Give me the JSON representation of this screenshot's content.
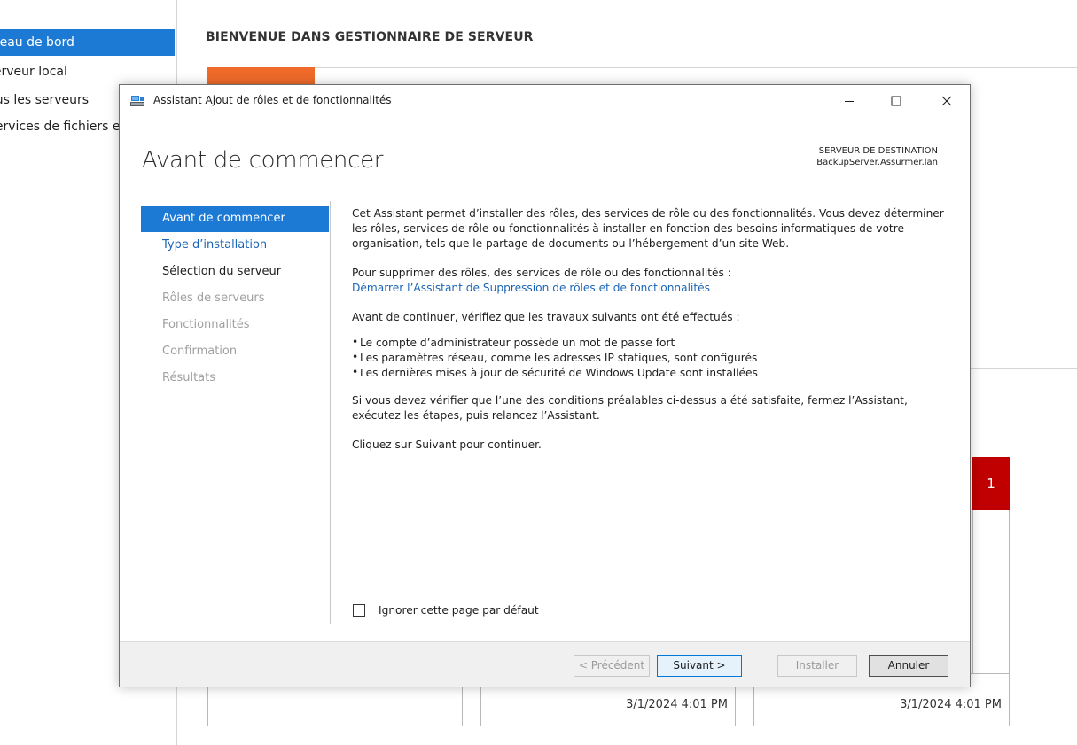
{
  "server_manager": {
    "nav": [
      {
        "label": "Tableau de bord",
        "active": true
      },
      {
        "label": "Serveur local",
        "active": false
      },
      {
        "label": "Tous les serveurs",
        "active": false
      },
      {
        "label": "Services de fichiers et de stockage",
        "active": false
      }
    ],
    "title": "BIENVENUE DANS GESTIONNAIRE DE SERVEUR",
    "badge_count": "1",
    "tile_timestamps": [
      "3/1/2024 4:01 PM",
      "3/1/2024 4:01 PM"
    ]
  },
  "wizard": {
    "window_title": "Assistant Ajout de rôles et de fonctionnalités",
    "heading": "Avant de commencer",
    "destination": {
      "label": "SERVEUR DE DESTINATION",
      "server": "BackupServer.Assurmer.lan"
    },
    "steps": [
      {
        "label": "Avant de commencer",
        "state": "active"
      },
      {
        "label": "Type d’installation",
        "state": "link"
      },
      {
        "label": "Sélection du serveur",
        "state": "normal"
      },
      {
        "label": "Rôles de serveurs",
        "state": "disabled"
      },
      {
        "label": "Fonctionnalités",
        "state": "disabled"
      },
      {
        "label": "Confirmation",
        "state": "disabled"
      },
      {
        "label": "Résultats",
        "state": "disabled"
      }
    ],
    "content": {
      "intro": "Cet Assistant permet d’installer des rôles, des services de rôle ou des fonctionnalités. Vous devez déterminer les rôles, services de rôle ou fonctionnalités à installer en fonction des besoins informatiques de votre organisation, tels que le partage de documents ou l’hébergement d’un site Web.",
      "remove_text": "Pour supprimer des rôles, des services de rôle ou des fonctionnalités :",
      "remove_link": "Démarrer l’Assistant de Suppression de rôles et de fonctionnalités",
      "prereq_intro": "Avant de continuer, vérifiez que les travaux suivants ont été effectués :",
      "prereqs": [
        "Le compte d’administrateur possède un mot de passe fort",
        "Les paramètres réseau, comme les adresses IP statiques, sont configurés",
        "Les dernières mises à jour de sécurité de Windows Update sont installées"
      ],
      "verify_text": "Si vous devez vérifier que l’une des conditions préalables ci-dessus a été satisfaite, fermez l’Assistant, exécutez les étapes, puis relancez l’Assistant.",
      "continue_text": "Cliquez sur Suivant pour continuer."
    },
    "skip_label": "Ignorer cette page par défaut",
    "buttons": {
      "previous": "< Précédent",
      "next": "Suivant >",
      "install": "Installer",
      "cancel": "Annuler"
    }
  }
}
